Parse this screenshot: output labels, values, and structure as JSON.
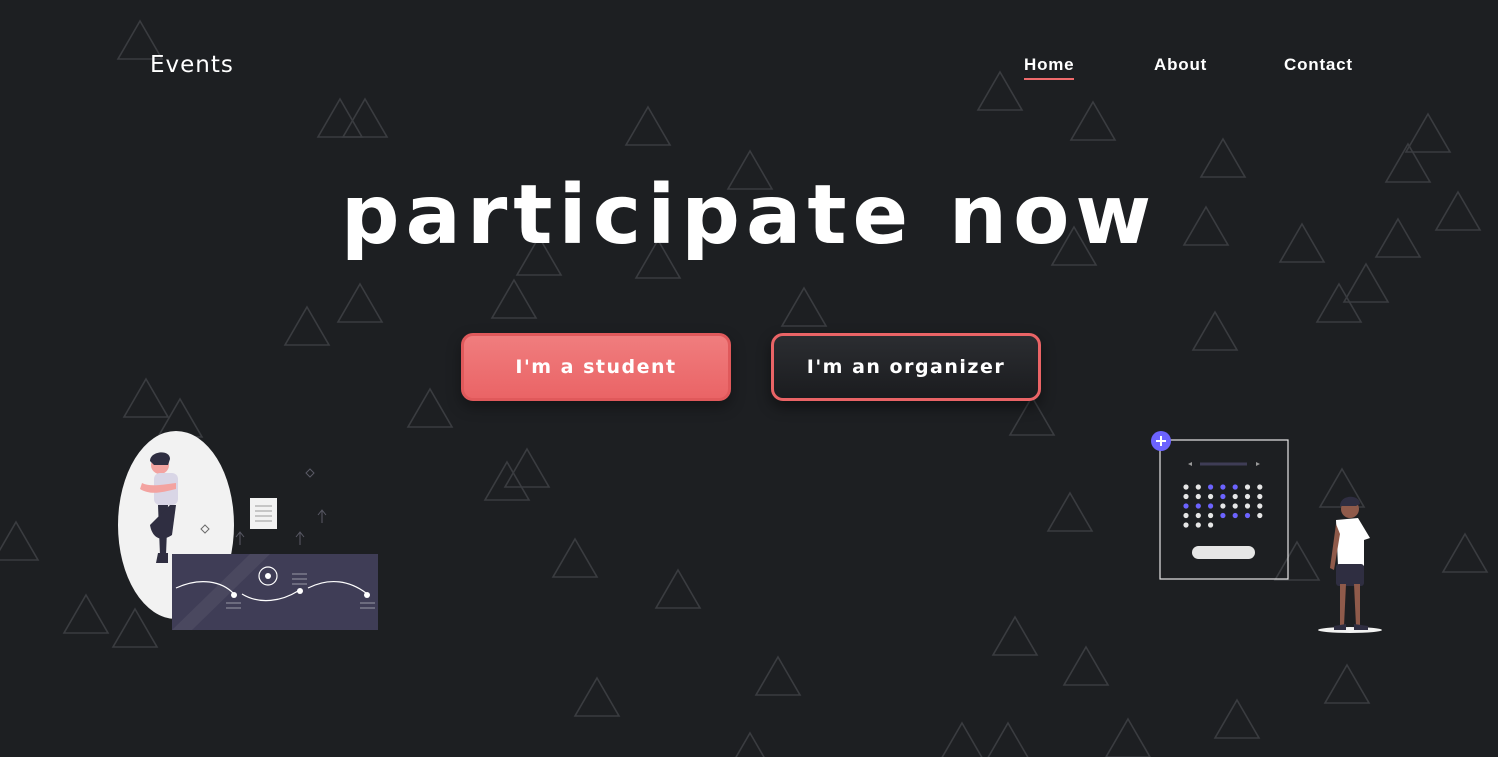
{
  "header": {
    "brand": "Events",
    "nav": [
      {
        "label": "Home",
        "active": true
      },
      {
        "label": "About",
        "active": false
      },
      {
        "label": "Contact",
        "active": false
      }
    ]
  },
  "hero": {
    "title": "participate now",
    "student_button": "I'm a student",
    "organizer_button": "I'm an organizer"
  },
  "colors": {
    "background": "#1d1f22",
    "accent": "#ea6466",
    "triangle_stroke": "#3a3c40",
    "illustration_purple": "#6c63ff",
    "illustration_panel": "#3f3d56"
  },
  "illustrations": [
    {
      "name": "student-illustration",
      "subject": "person standing beside workflow panel"
    },
    {
      "name": "organizer-illustration",
      "subject": "person looking at calendar board"
    }
  ]
}
